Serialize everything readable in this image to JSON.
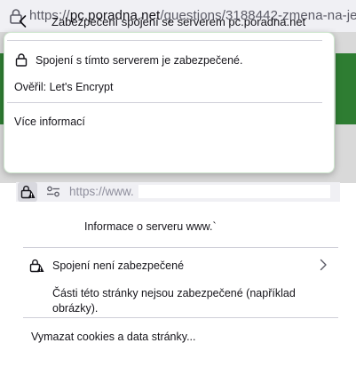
{
  "top_bar": {
    "url_scheme": "https://",
    "url_host": "pc.poradna.net",
    "url_path": "/questions/3188442-zmena-na-je"
  },
  "identity_panel": {
    "title": "Zabezpečení spojení se serverem pc.poradna.net",
    "secure_status": "Spojení s tímto serverem je zabezpečené.",
    "verified_by": "Ověřil: Let's Encrypt",
    "more_info": "Více informací"
  },
  "second_bar": {
    "url_text": "https://www."
  },
  "insecure_panel": {
    "title": "Informace o serveru www.`",
    "status": "Spojení není zabezpečené",
    "detail": "Části této stránky nejsou zabezpečené (například obrázky).",
    "clear_cookies": "Vymazat cookies a data stránky..."
  },
  "icons": {
    "lock": "lock-icon",
    "back": "chevron-left-icon",
    "warning_lock": "lock-warning-icon",
    "permissions": "permissions-icon",
    "forward": "chevron-right-icon"
  }
}
